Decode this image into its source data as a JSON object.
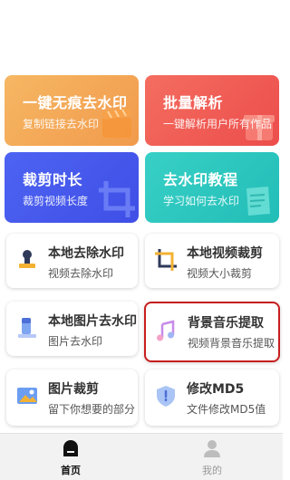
{
  "features": {
    "watermark_remove": {
      "title": "一键无痕去水印",
      "subtitle": "复制链接去水印"
    },
    "batch_parse": {
      "title": "批量解析",
      "subtitle": "一键解析用户所有作品"
    },
    "trim_duration": {
      "title": "裁剪时长",
      "subtitle": "裁剪视频长度"
    },
    "tutorial": {
      "title": "去水印教程",
      "subtitle": "学习如何去水印"
    },
    "local_watermark": {
      "title": "本地去除水印",
      "subtitle": "视频去除水印"
    },
    "local_video_crop": {
      "title": "本地视频裁剪",
      "subtitle": "视频大小裁剪"
    },
    "local_image_watermark": {
      "title": "本地图片去水印",
      "subtitle": "图片去水印"
    },
    "bg_music": {
      "title": "背景音乐提取",
      "subtitle": "视频背景音乐提取"
    },
    "image_crop": {
      "title": "图片裁剪",
      "subtitle": "留下你想要的部分"
    },
    "md5": {
      "title": "修改MD5",
      "subtitle": "文件修改MD5值"
    }
  },
  "tabbar": {
    "home": {
      "label": "首页",
      "icon": "home-icon",
      "active": true
    },
    "mine": {
      "label": "我的",
      "icon": "user-icon",
      "active": false
    }
  },
  "colors": {
    "orange_card": "#f3a756",
    "red_card": "#f05c55",
    "blue_card": "#4a5bef",
    "teal_card": "#2dc7c0",
    "highlight_border": "#c81e1e",
    "tab_active": "#111111",
    "tab_inactive": "#999999"
  }
}
